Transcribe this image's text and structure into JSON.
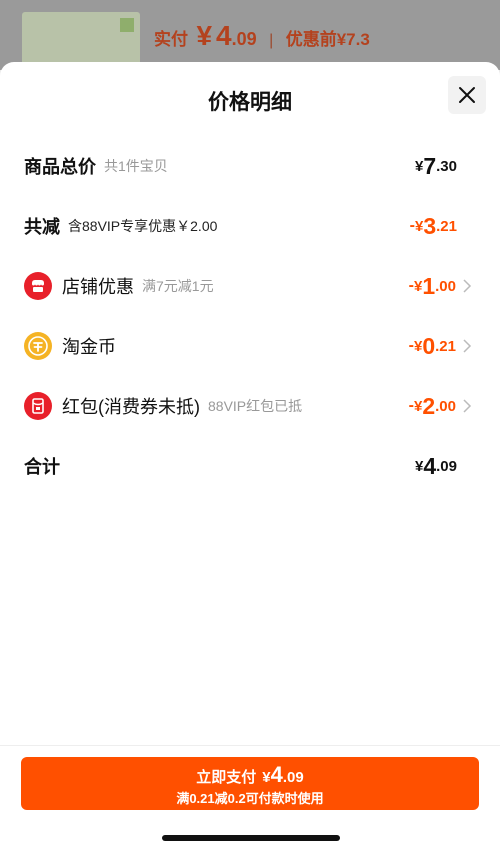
{
  "background": {
    "price_label": "实付",
    "price_currency": "¥",
    "price_int": "4",
    "price_dec": ".09",
    "separator": "|",
    "original_price": "优惠前¥7.3"
  },
  "sheet": {
    "title": "价格明细",
    "rows": [
      {
        "label": "商品总价",
        "sub": "共1件宝贝",
        "currency": "¥",
        "int": "7",
        "dec": ".30",
        "minus": ""
      },
      {
        "label": "共减",
        "sub": "含88VIP专享优惠￥2.00",
        "currency": "¥",
        "int": "3",
        "dec": ".21",
        "minus": "-"
      },
      {
        "label": "店铺优惠",
        "sub": "满7元减1元",
        "currency": "¥",
        "int": "1",
        "dec": ".00",
        "minus": "-",
        "icon": "shop-icon"
      },
      {
        "label": "淘金币",
        "sub": "",
        "currency": "¥",
        "int": "0",
        "dec": ".21",
        "minus": "-",
        "icon": "gold-coin-icon"
      },
      {
        "label": "红包(消费券未抵)",
        "sub": "88VIP红包已抵",
        "currency": "¥",
        "int": "2",
        "dec": ".00",
        "minus": "-",
        "icon": "red-envelope-icon"
      },
      {
        "label": "合计",
        "sub": "",
        "currency": "¥",
        "int": "4",
        "dec": ".09",
        "minus": ""
      }
    ]
  },
  "pay_button": {
    "label": "立即支付",
    "currency": "¥",
    "int": "4",
    "dec": ".09",
    "note": "满0.21减0.2可付款时使用"
  },
  "colors": {
    "accent": "#ff5000",
    "icon_red": "#e8202a",
    "icon_gold": "#f5b324"
  }
}
